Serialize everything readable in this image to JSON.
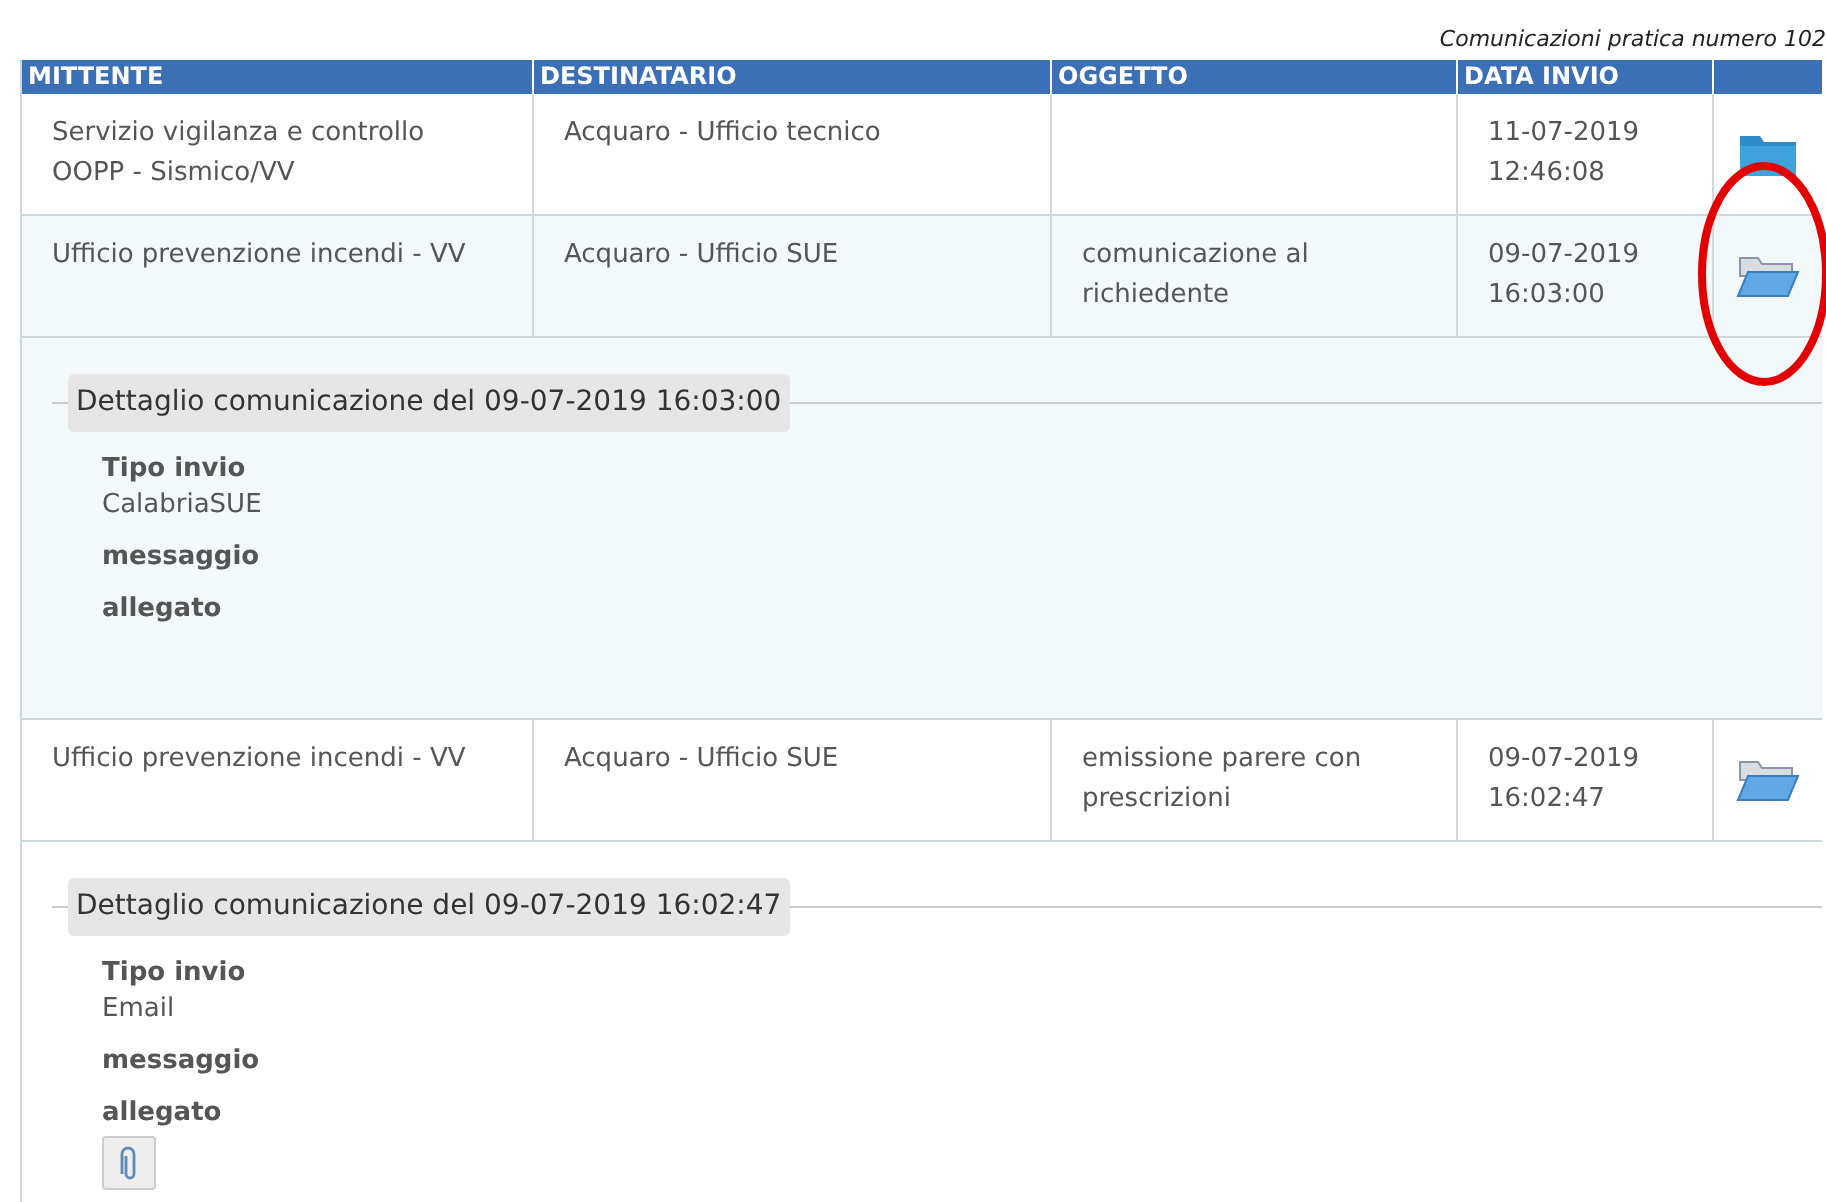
{
  "caption": "Comunicazioni pratica numero 102",
  "table": {
    "columns": [
      "MITTENTE",
      "DESTINATARIO",
      "OGGETTO",
      "DATA INVIO"
    ],
    "rows": [
      {
        "mittente": "Servizio vigilanza e controllo OOPP - Sismico/VV",
        "destinatario": "Acquaro - Ufficio tecnico",
        "oggetto": "",
        "data": "11-07-2019",
        "ora": "12:46:08",
        "expanded": false,
        "selected": false
      },
      {
        "mittente": "Ufficio prevenzione incendi - VV",
        "destinatario": "Acquaro - Ufficio SUE",
        "oggetto": "comunicazione al richiedente",
        "data": "09-07-2019",
        "ora": "16:03:00",
        "expanded": true,
        "selected": true,
        "detail": {
          "title": "Dettaglio comunicazione del 09-07-2019 16:03:00",
          "tipo_label": "Tipo invio",
          "tipo": "CalabriaSUE",
          "messaggio_label": "messaggio",
          "allegato_label": "allegato",
          "attachment": false
        }
      },
      {
        "mittente": "Ufficio prevenzione incendi - VV",
        "destinatario": "Acquaro - Ufficio SUE",
        "oggetto": "emissione parere con prescrizioni",
        "data": "09-07-2019",
        "ora": "16:02:47",
        "expanded": true,
        "selected": false,
        "detail": {
          "title": "Dettaglio comunicazione del 09-07-2019 16:02:47",
          "tipo_label": "Tipo invio",
          "tipo": "Email",
          "messaggio_label": "messaggio",
          "allegato_label": "allegato",
          "attachment": true
        }
      }
    ]
  },
  "highlight_annotation": true
}
